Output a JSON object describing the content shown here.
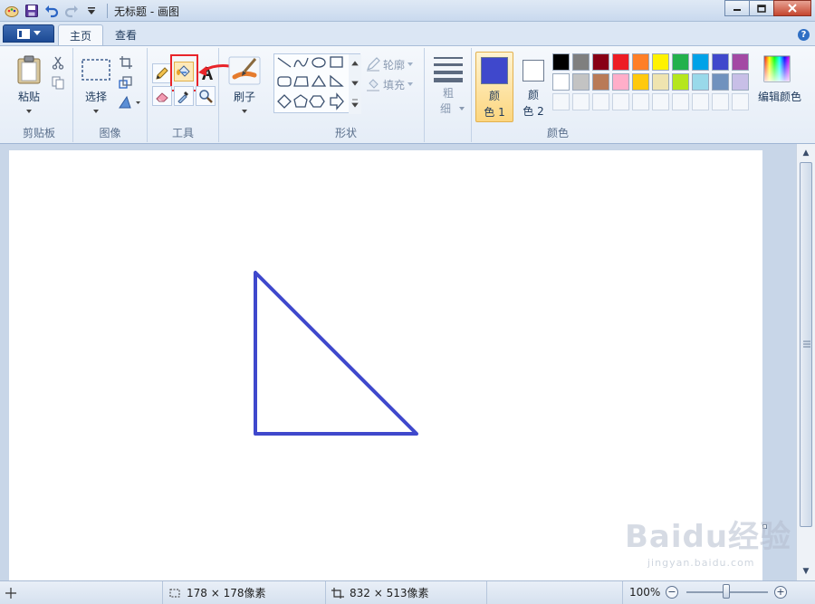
{
  "window": {
    "title": "无标题 - 画图"
  },
  "tabs": [
    {
      "label": "主页"
    },
    {
      "label": "查看"
    }
  ],
  "help_label": "?",
  "groups": {
    "clipboard": {
      "label": "剪贴板",
      "paste_label": "粘贴"
    },
    "image": {
      "label": "图像",
      "select_label": "选择"
    },
    "tools": {
      "label": "工具"
    },
    "brushes": {
      "label": "刷子"
    },
    "shapes": {
      "label": "形状",
      "outline_label": "轮廓",
      "fill_label": "填充"
    },
    "size": {
      "label_top": "粗",
      "label_bottom": "细"
    },
    "colors": {
      "label": "颜色",
      "color1_top": "颜",
      "color1_bottom": "色 1",
      "color2_top": "颜",
      "color2_bottom": "色 2",
      "edit_label": "编辑颜色",
      "color1_value": "#3f48cc",
      "color2_value": "#ffffff",
      "palette_row1": [
        "#000000",
        "#7f7f7f",
        "#880015",
        "#ed1c24",
        "#ff7f27",
        "#fff200",
        "#22b14c",
        "#00a2e8",
        "#3f48cc",
        "#a349a4"
      ],
      "palette_row2": [
        "#ffffff",
        "#c3c3c3",
        "#b97a57",
        "#ffaec9",
        "#ffc90e",
        "#efe4b0",
        "#b5e61d",
        "#99d9ea",
        "#7092be",
        "#c8bfe7"
      ]
    }
  },
  "canvas": {
    "stroke_color": "#3f48cc"
  },
  "status": {
    "selection_size": "178 × 178像素",
    "image_size": "832 × 513像素",
    "zoom": "100%"
  },
  "watermark": {
    "main": "Baidu经验",
    "sub": "jingyan.baidu.com"
  }
}
